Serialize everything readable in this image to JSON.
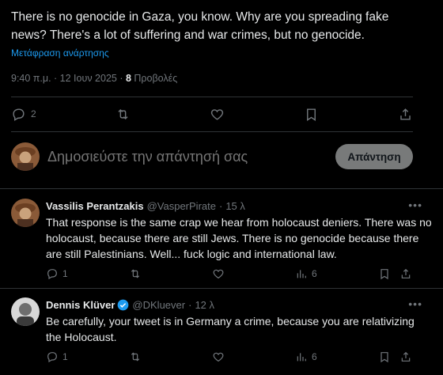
{
  "main_tweet": {
    "text": "There is no genocide in Gaza, you know. Why are you spreading fake\nnews? There's a lot of suffering and war crimes, but no genocide.",
    "translate_label": "Μετάφραση ανάρτησης",
    "time": "9:40 π.μ. · 12 Ιουν 2025 · ",
    "views_count": "8",
    "views_label": " Προβολές",
    "actions": {
      "reply_count": "2"
    }
  },
  "reply_box": {
    "placeholder": "Δημοσιεύστε την απάντησή σας",
    "button_label": "Απάντηση"
  },
  "replies": [
    {
      "name": "Vassilis Perantzakis",
      "handle": "@VasperPirate",
      "time": "15 λ",
      "text": "That response is the same crap we hear from holocaust deniers.  There was no holocaust, because there are still Jews. There is no genocide because there are still Palestinians. Well... fuck logic and international law.",
      "reply_count": "1",
      "views": "6",
      "verified": false
    },
    {
      "name": "Dennis Klüver",
      "handle": "@DKluever",
      "time": "12 λ",
      "text": "Be carefully, your tweet is in Germany  a crime, because you are relativizing the Holocaust.",
      "reply_count": "1",
      "views": "6",
      "verified": true
    }
  ],
  "colors": {
    "accent": "#1d9bf0",
    "muted": "#71767b",
    "text": "#e7e9ea",
    "bg": "#000000",
    "divider": "#2f3336"
  },
  "icons": [
    "reply-icon",
    "retweet-icon",
    "like-icon",
    "bookmark-icon",
    "share-icon",
    "views-icon",
    "more-icon",
    "verified-icon"
  ]
}
